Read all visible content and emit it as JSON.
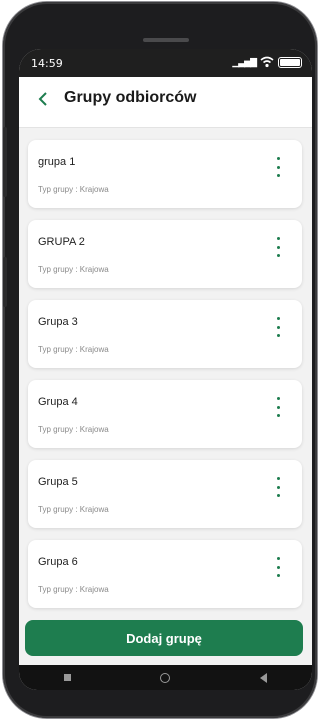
{
  "status": {
    "time": "14:59",
    "signal": "4G",
    "wifi_icon": "wifi-icon",
    "battery_icon": "battery-icon"
  },
  "header": {
    "title": "Grupy odbiorców",
    "back_icon": "chevron-left-icon"
  },
  "groups": [
    {
      "name": "grupa 1",
      "type": "Typ grupy : Krajowa"
    },
    {
      "name": "GRUPA 2",
      "type": "Typ grupy : Krajowa"
    },
    {
      "name": "Grupa 3",
      "type": "Typ grupy : Krajowa"
    },
    {
      "name": "Grupa 4",
      "type": "Typ grupy : Krajowa"
    },
    {
      "name": "Grupa 5",
      "type": "Typ grupy : Krajowa"
    },
    {
      "name": "Grupa 6",
      "type": "Typ grupy : Krajowa"
    }
  ],
  "actions": {
    "add_group_label": "Dodaj grupę"
  },
  "colors": {
    "accent": "#1e7d4f",
    "screen_bg": "#f2f2f2",
    "status_bar": "#1f1f1f"
  }
}
